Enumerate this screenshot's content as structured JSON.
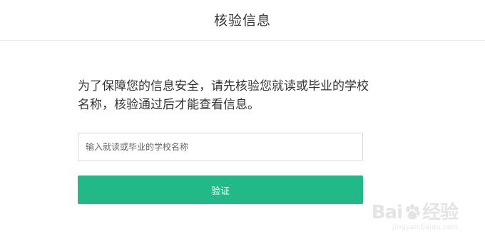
{
  "header": {
    "title": "核验信息"
  },
  "main": {
    "description": "为了保障您的信息安全，请先核验您就读或毕业的学校名称，核验通过后才能查看信息。",
    "school_input": {
      "value": "",
      "placeholder": "输入就读或毕业的学校名称"
    },
    "verify_label": "验证"
  },
  "watermark": {
    "brand_left": "Bai",
    "brand_right": "经验",
    "site": "jingyan.baidu.com"
  },
  "colors": {
    "accent": "#23b887",
    "divider": "#e8e8e8"
  },
  "icons": {
    "watermark_logo": "baidu-paw-icon"
  }
}
